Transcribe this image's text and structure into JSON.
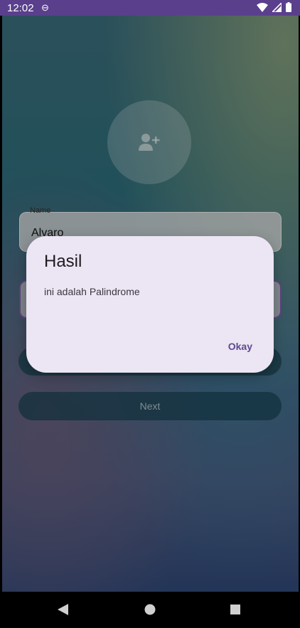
{
  "status_bar": {
    "time": "12:02",
    "icons": [
      "sync-icon",
      "wifi-icon",
      "signal-icon",
      "battery-icon"
    ]
  },
  "form": {
    "avatar_icon": "add-person-icon",
    "name_label": "Name",
    "name_value": "Alvaro",
    "check_label": "",
    "next_label": "Next"
  },
  "dialog": {
    "title": "Hasil",
    "message": "ini adalah Palindrome",
    "okay_label": "Okay"
  },
  "nav": {
    "icons": [
      "back-icon",
      "home-icon",
      "recents-icon"
    ]
  },
  "colors": {
    "status_bar": "#5a3f8c",
    "dialog_bg": "#ece5f3",
    "accent": "#5e4a8f",
    "focus_border": "#7d5aa8"
  }
}
